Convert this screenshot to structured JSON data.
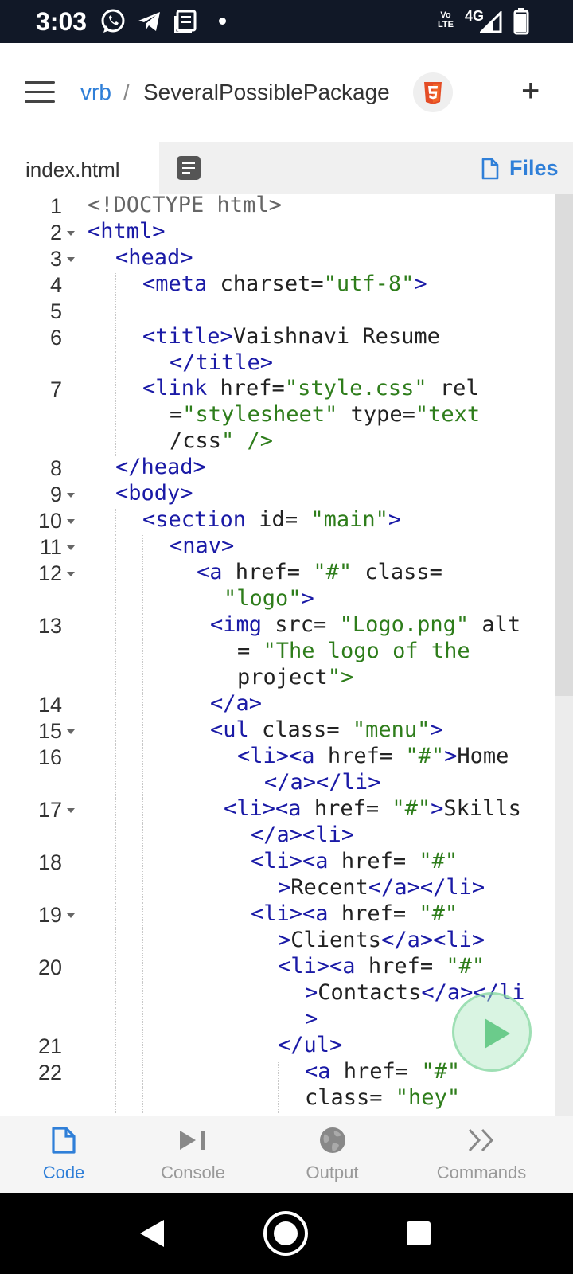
{
  "status_bar": {
    "time": "3:03",
    "network": "4G",
    "volte": "Vo LTE"
  },
  "header": {
    "owner": "vrb",
    "separator": "/",
    "project": "SeveralPossiblePackage"
  },
  "tabs": {
    "active_file": "index.html",
    "files_label": "Files"
  },
  "editor": {
    "lines": [
      {
        "n": "1",
        "text": "<!DOCTYPE html>"
      },
      {
        "n": "2",
        "text": "<html>"
      },
      {
        "n": "3",
        "text": "<head>"
      },
      {
        "n": "4",
        "text": "<meta charset=\"utf-8\">"
      },
      {
        "n": "5",
        "text": ""
      },
      {
        "n": "6",
        "text": "<title>Vaishnavi Resume"
      },
      {
        "n": "",
        "text": "</title>"
      },
      {
        "n": "7",
        "text": "<link href=\"style.css\" rel"
      },
      {
        "n": "",
        "text": "=\"stylesheet\" type=\"text"
      },
      {
        "n": "",
        "text": "/css\" />"
      },
      {
        "n": "8",
        "text": "</head>"
      },
      {
        "n": "9",
        "text": "<body>"
      },
      {
        "n": "10",
        "text": "<section id= \"main\">"
      },
      {
        "n": "11",
        "text": "<nav>"
      },
      {
        "n": "12",
        "text": "<a href= \"#\" class="
      },
      {
        "n": "",
        "text": "\"logo\">"
      },
      {
        "n": "13",
        "text": "<img src= \"Logo.png\" alt"
      },
      {
        "n": "",
        "text": "= \"The logo of the"
      },
      {
        "n": "",
        "text": "project\">"
      },
      {
        "n": "14",
        "text": "</a>"
      },
      {
        "n": "15",
        "text": "<ul class= \"menu\">"
      },
      {
        "n": "16",
        "text": "<li><a href= \"#\">Home"
      },
      {
        "n": "",
        "text": "</a></li>"
      },
      {
        "n": "17",
        "text": "<li><a href= \"#\">Skills"
      },
      {
        "n": "",
        "text": "</a><li>"
      },
      {
        "n": "18",
        "text": "<li><a href= \"#\""
      },
      {
        "n": "",
        "text": ">Recent</a></li>"
      },
      {
        "n": "19",
        "text": "<li><a href= \"#\""
      },
      {
        "n": "",
        "text": ">Clients</a><li>"
      },
      {
        "n": "20",
        "text": "<li><a href= \"#\""
      },
      {
        "n": "",
        "text": ">Contacts</a></li"
      },
      {
        "n": "",
        "text": ">"
      },
      {
        "n": "21",
        "text": "</ul>"
      },
      {
        "n": "22",
        "text": "<a href= \"#\""
      },
      {
        "n": "",
        "text": "class= \"hey\""
      }
    ]
  },
  "bottom_nav": {
    "items": [
      {
        "label": "Code",
        "icon": "file-icon",
        "active": true
      },
      {
        "label": "Console",
        "icon": "console-icon",
        "active": false
      },
      {
        "label": "Output",
        "icon": "globe-icon",
        "active": false
      },
      {
        "label": "Commands",
        "icon": "chevrons-right-icon",
        "active": false
      }
    ]
  },
  "colors": {
    "accent": "#2f7fd8",
    "tag": "#1a1aa6",
    "string": "#2e7d1b",
    "status_bar": "#111827"
  }
}
